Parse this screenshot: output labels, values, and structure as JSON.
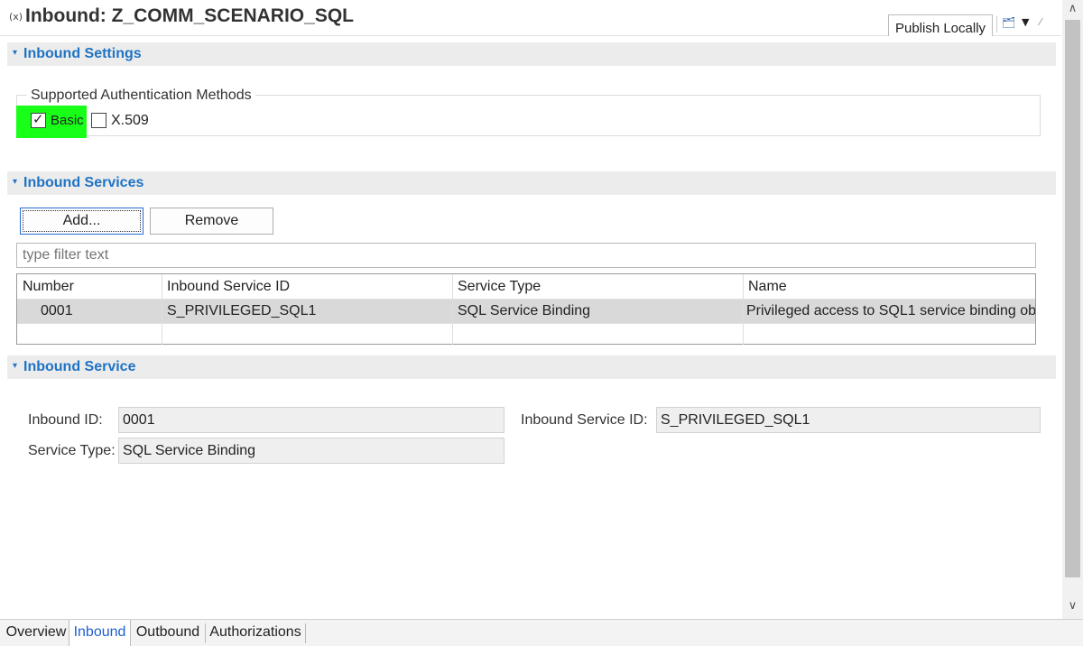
{
  "editor": {
    "title_icon": "(x)",
    "title": "Inbound: Z_COMM_SCENARIO_SQL",
    "publish_label": "Publish Locally"
  },
  "sections": {
    "inbound_settings": "Inbound Settings",
    "inbound_services": "Inbound Services",
    "inbound_service": "Inbound Service"
  },
  "auth": {
    "group_label": "Supported Authentication Methods",
    "basic_label": "Basic",
    "basic_checked": true,
    "x509_label": "X.509",
    "x509_checked": false,
    "highlight_color": "#18ff18"
  },
  "services": {
    "add_label": "Add...",
    "remove_label": "Remove",
    "filter_placeholder": "type filter text",
    "columns": [
      "Number",
      "Inbound Service ID",
      "Service Type",
      "Name"
    ],
    "rows": [
      [
        "0001",
        "S_PRIVILEGED_SQL1",
        "SQL Service Binding",
        "Privileged access to SQL1 service binding ob"
      ]
    ]
  },
  "detail": {
    "inbound_id_label": "Inbound ID:",
    "inbound_id_value": "0001",
    "service_id_label": "Inbound Service ID:",
    "service_id_value": "S_PRIVILEGED_SQL1",
    "service_type_label": "Service Type:",
    "service_type_value": "SQL Service Binding"
  },
  "tabs": [
    "Overview",
    "Inbound",
    "Outbound",
    "Authorizations"
  ],
  "active_tab": "Inbound",
  "icons": [
    "variable-icon",
    "deploy-icon",
    "dropdown-arrow-icon",
    "pin-icon",
    "scroll-up-icon",
    "scroll-down-icon",
    "section-collapse-icon",
    "checkmark-icon"
  ],
  "colors": {
    "section_title": "#1f73c4",
    "active_tab": "#1f5fd1"
  }
}
